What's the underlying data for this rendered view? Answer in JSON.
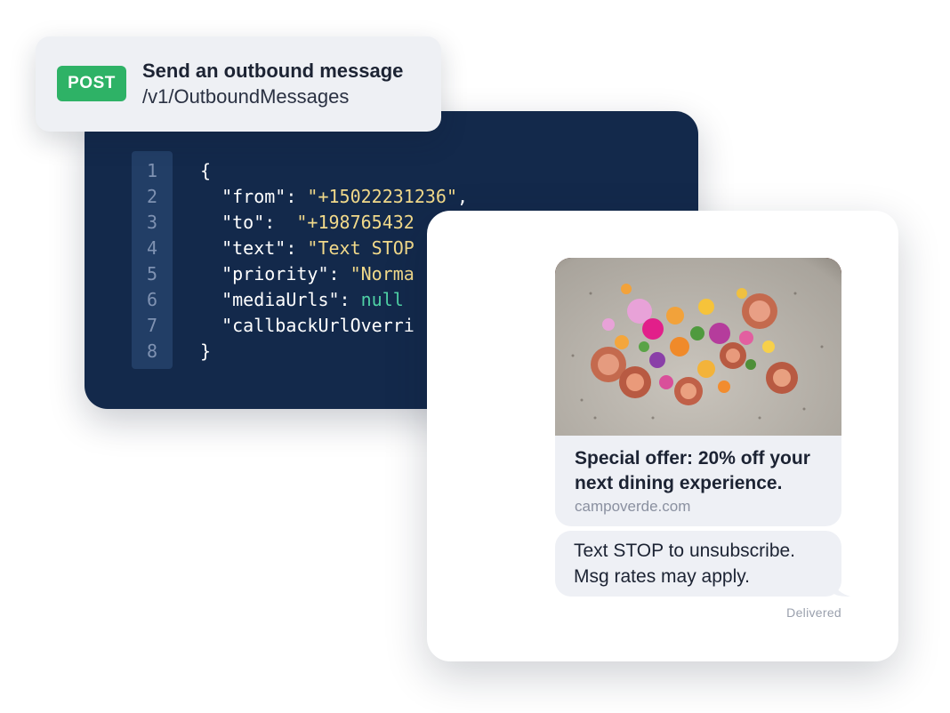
{
  "endpoint": {
    "method": "POST",
    "title": "Send an outbound message",
    "path": "/v1/OutboundMessages"
  },
  "code": {
    "line_numbers": [
      "1",
      "2",
      "3",
      "4",
      "5",
      "6",
      "7",
      "8"
    ],
    "lines": [
      {
        "parts": [
          {
            "t": "{",
            "k": "punct"
          }
        ]
      },
      {
        "parts": [
          {
            "t": "  \"from\"",
            "k": "key"
          },
          {
            "t": ": ",
            "k": "punct"
          },
          {
            "t": "\"+15022231236\"",
            "k": "str"
          },
          {
            "t": ",",
            "k": "punct"
          }
        ]
      },
      {
        "parts": [
          {
            "t": "  \"to\"",
            "k": "key"
          },
          {
            "t": ":  ",
            "k": "punct"
          },
          {
            "t": "\"+198765432",
            "k": "str"
          }
        ]
      },
      {
        "parts": [
          {
            "t": "  \"text\"",
            "k": "key"
          },
          {
            "t": ": ",
            "k": "punct"
          },
          {
            "t": "\"Text STOP",
            "k": "str"
          }
        ]
      },
      {
        "parts": [
          {
            "t": "  \"priority\"",
            "k": "key"
          },
          {
            "t": ": ",
            "k": "punct"
          },
          {
            "t": "\"Norma",
            "k": "str"
          }
        ]
      },
      {
        "parts": [
          {
            "t": "  \"mediaUrls\"",
            "k": "key"
          },
          {
            "t": ": ",
            "k": "punct"
          },
          {
            "t": "null",
            "k": "null"
          }
        ]
      },
      {
        "parts": [
          {
            "t": "  \"callbackUrlOverri",
            "k": "key"
          }
        ]
      },
      {
        "parts": [
          {
            "t": "}",
            "k": "punct"
          }
        ]
      }
    ]
  },
  "message": {
    "image_alt": "plate-of-figs-and-edible-flowers",
    "headline": "Special offer: 20% off your next dining experience.",
    "domain": "campoverde.com",
    "body": "Text STOP to unsubscribe. Msg rates may apply.",
    "status": "Delivered"
  },
  "colors": {
    "code_bg": "#13294b",
    "badge_green": "#2eb266",
    "bubble_bg": "#eef0f5",
    "string_yellow": "#f1d98a",
    "null_green": "#4fd1a5"
  }
}
